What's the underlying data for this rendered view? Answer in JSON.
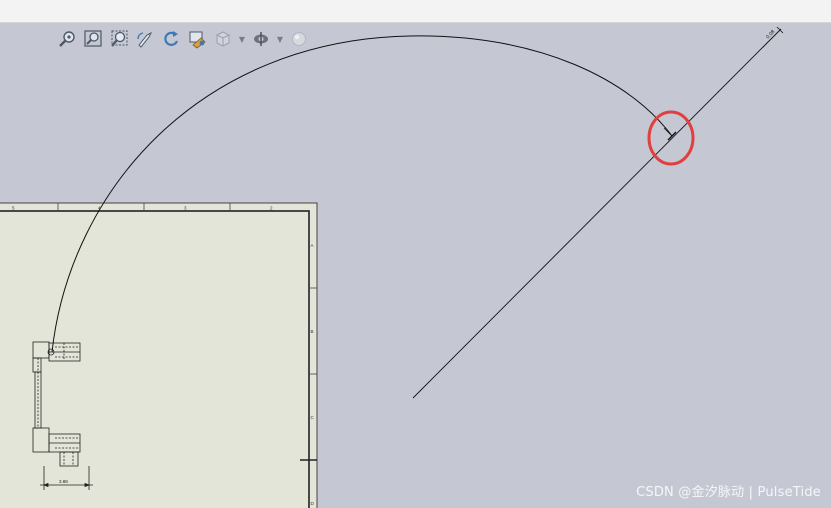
{
  "toolbar": {
    "icons": [
      "zoom-to-fit-icon",
      "zoom-to-area-icon",
      "zoom-in-out-icon",
      "rotate-view-icon",
      "redo-view-icon",
      "display-style-icon",
      "view-orientation-icon",
      "hide-show-icon",
      "appearance-icon"
    ]
  },
  "drawing": {
    "dimension_label": "0.08",
    "part_dimension_label": "3.88",
    "border_marks_top": [
      "5",
      "4",
      "3",
      "2"
    ],
    "border_marks_right": [
      "A",
      "B",
      "C",
      "D"
    ]
  },
  "watermark": {
    "text": "CSDN @金汐脉动 | PulseTide"
  },
  "colors": {
    "background": "#c5c7d3",
    "sheet": "#e3e5d8",
    "highlight": "#e04040"
  }
}
